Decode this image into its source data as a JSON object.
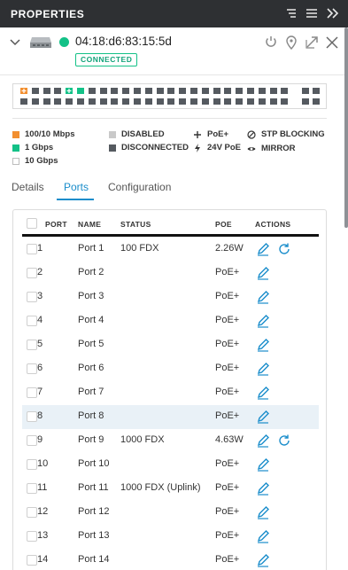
{
  "panel": {
    "title": "PROPERTIES"
  },
  "device": {
    "mac": "04:18:d6:83:15:5d",
    "status": "CONNECTED",
    "status_color": "#13c187"
  },
  "legend": {
    "speed_100": "100/10 Mbps",
    "speed_1g": "1 Gbps",
    "speed_10g": "10 Gbps",
    "disabled": "DISABLED",
    "disconnected": "DISCONNECTED",
    "poe_plus": "PoE+",
    "poe_24v": "24V PoE",
    "stp": "STP BLOCKING",
    "mirror": "MIRROR",
    "colors": {
      "speed_100": "#f28f30",
      "speed_1g": "#13c187",
      "disabled": "#c9c9c9",
      "disconnected": "#555a60"
    }
  },
  "tabs": [
    "Details",
    "Ports",
    "Configuration"
  ],
  "active_tab": "Ports",
  "table": {
    "headers": {
      "port": "PORT",
      "name": "NAME",
      "status": "STATUS",
      "poe": "POE",
      "actions": "ACTIONS"
    },
    "rows": [
      {
        "port": "1",
        "name": "Port 1",
        "status": "100 FDX",
        "poe": "2.26W"
      },
      {
        "port": "2",
        "name": "Port 2",
        "status": "",
        "poe": "PoE+"
      },
      {
        "port": "3",
        "name": "Port 3",
        "status": "",
        "poe": "PoE+"
      },
      {
        "port": "4",
        "name": "Port 4",
        "status": "",
        "poe": "PoE+"
      },
      {
        "port": "5",
        "name": "Port 5",
        "status": "",
        "poe": "PoE+"
      },
      {
        "port": "6",
        "name": "Port 6",
        "status": "",
        "poe": "PoE+"
      },
      {
        "port": "7",
        "name": "Port 7",
        "status": "",
        "poe": "PoE+"
      },
      {
        "port": "8",
        "name": "Port 8",
        "status": "",
        "poe": "PoE+"
      },
      {
        "port": "9",
        "name": "Port 9",
        "status": "1000 FDX",
        "poe": "4.63W"
      },
      {
        "port": "10",
        "name": "Port 10",
        "status": "",
        "poe": "PoE+"
      },
      {
        "port": "11",
        "name": "Port 11",
        "status": "1000 FDX (Uplink)",
        "poe": "PoE+"
      },
      {
        "port": "12",
        "name": "Port 12",
        "status": "",
        "poe": "PoE+"
      },
      {
        "port": "13",
        "name": "Port 13",
        "status": "",
        "poe": "PoE+"
      },
      {
        "port": "14",
        "name": "Port 14",
        "status": "",
        "poe": "PoE+"
      }
    ]
  }
}
